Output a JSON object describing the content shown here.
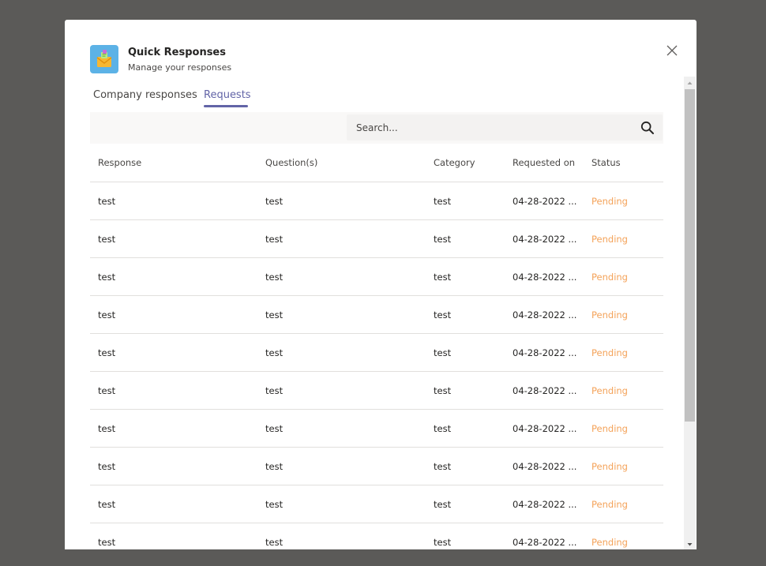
{
  "dialog": {
    "title": "Quick Responses",
    "subtitle": "Manage your responses",
    "app_icon": "envelope-icon",
    "close_icon": "close-icon"
  },
  "tabs": [
    {
      "label": "Company responses",
      "active": false
    },
    {
      "label": "Requests",
      "active": true
    }
  ],
  "search": {
    "placeholder": "Search...",
    "value": "",
    "icon": "search-icon"
  },
  "table": {
    "headers": {
      "response": "Response",
      "questions": "Question(s)",
      "category": "Category",
      "requested_on": "Requested on",
      "status": "Status"
    },
    "rows": [
      {
        "response": "test",
        "questions": "test",
        "category": "test",
        "requested_on": "04-28-2022 ...",
        "status": "Pending"
      },
      {
        "response": "test",
        "questions": "test",
        "category": "test",
        "requested_on": "04-28-2022 ...",
        "status": "Pending"
      },
      {
        "response": "test",
        "questions": "test",
        "category": "test",
        "requested_on": "04-28-2022 ...",
        "status": "Pending"
      },
      {
        "response": "test",
        "questions": "test",
        "category": "test",
        "requested_on": "04-28-2022 ...",
        "status": "Pending"
      },
      {
        "response": "test",
        "questions": "test",
        "category": "test",
        "requested_on": "04-28-2022 ...",
        "status": "Pending"
      },
      {
        "response": "test",
        "questions": "test",
        "category": "test",
        "requested_on": "04-28-2022 ...",
        "status": "Pending"
      },
      {
        "response": "test",
        "questions": "test",
        "category": "test",
        "requested_on": "04-28-2022 ...",
        "status": "Pending"
      },
      {
        "response": "test",
        "questions": "test",
        "category": "test",
        "requested_on": "04-28-2022 ...",
        "status": "Pending"
      },
      {
        "response": "test",
        "questions": "test",
        "category": "test",
        "requested_on": "04-28-2022 ...",
        "status": "Pending"
      },
      {
        "response": "test",
        "questions": "test",
        "category": "test",
        "requested_on": "04-28-2022 ...",
        "status": "Pending"
      }
    ]
  },
  "colors": {
    "accent": "#6264a7",
    "pending": "#f4a35a",
    "backdrop": "#5b5a58",
    "app_icon_bg": "#5cb2e6"
  }
}
